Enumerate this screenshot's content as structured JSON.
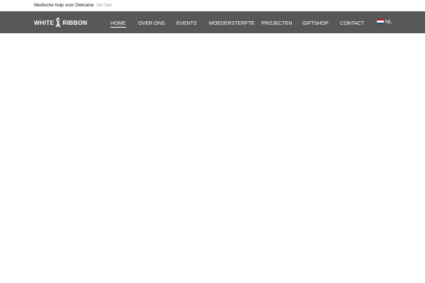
{
  "topbar": {
    "message": "Medische hulp voor Oekraine",
    "link": "klik hier"
  },
  "header": {
    "logo_left": "WHITE",
    "logo_right": "RIBBON",
    "logo_icon": "ribbon-icon"
  },
  "nav": {
    "items": [
      {
        "label": "HOME",
        "active": true
      },
      {
        "label": "OVER ONS"
      },
      {
        "label": "EVENTS"
      },
      {
        "label": "MOEDERSTERFTE"
      },
      {
        "label": "PROJECTEN"
      },
      {
        "label": "GIFTSHOP"
      },
      {
        "label": "CONTACT"
      }
    ],
    "language": "NL",
    "language_icon": "flag-nl-icon"
  },
  "colors": {
    "navbar_bg": "#565656",
    "link_gray": "#9a9a9a",
    "flag_red": "#c8102e",
    "flag_white": "#ffffff",
    "flag_blue": "#21468b"
  }
}
